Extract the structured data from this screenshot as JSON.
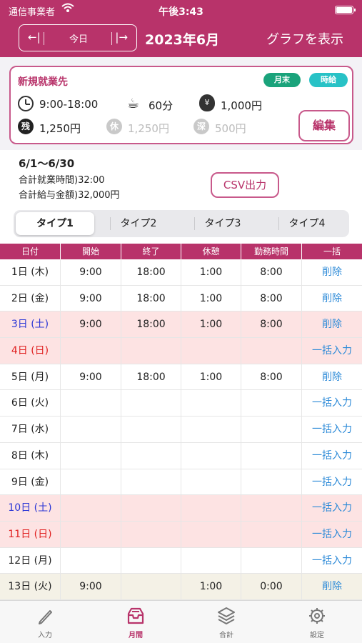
{
  "status": {
    "carrier": "通信事業者",
    "time": "午後3:43"
  },
  "header": {
    "prev": "←|",
    "today": "今日",
    "next": "|→",
    "month": "2023年6月",
    "graph": "グラフを表示"
  },
  "card": {
    "title": "新規就業先",
    "badge_month": "月末",
    "badge_hourly": "時給",
    "work_time": "9:00-18:00",
    "break": "60分",
    "wage": "1,000円",
    "overtime_label": "残",
    "overtime": "1,250円",
    "holiday_label": "休",
    "holiday": "1,250円",
    "night_label": "深",
    "night": "500円",
    "edit": "編集",
    "yen_symbol": "¥"
  },
  "summary": {
    "range": "6/1～6/30",
    "hours": "合計就業時間)32:00",
    "pay": "合計給与金額)32,000円",
    "csv": "CSV出力"
  },
  "segments": [
    "タイプ1",
    "タイプ2",
    "タイプ3",
    "タイプ4"
  ],
  "table": {
    "headers": [
      "日付",
      "開始",
      "終了",
      "休憩",
      "勤務時間",
      "一括"
    ],
    "rows": [
      {
        "date": "1日 (木)",
        "start": "9:00",
        "end": "18:00",
        "rest": "1:00",
        "work": "8:00",
        "action": "削除",
        "kind": ""
      },
      {
        "date": "2日 (金)",
        "start": "9:00",
        "end": "18:00",
        "rest": "1:00",
        "work": "8:00",
        "action": "削除",
        "kind": ""
      },
      {
        "date": "3日 (土)",
        "start": "9:00",
        "end": "18:00",
        "rest": "1:00",
        "work": "8:00",
        "action": "削除",
        "kind": "sat"
      },
      {
        "date": "4日 (日)",
        "start": "",
        "end": "",
        "rest": "",
        "work": "",
        "action": "一括入力",
        "kind": "sun"
      },
      {
        "date": "5日 (月)",
        "start": "9:00",
        "end": "18:00",
        "rest": "1:00",
        "work": "8:00",
        "action": "削除",
        "kind": ""
      },
      {
        "date": "6日 (火)",
        "start": "",
        "end": "",
        "rest": "",
        "work": "",
        "action": "一括入力",
        "kind": ""
      },
      {
        "date": "7日 (水)",
        "start": "",
        "end": "",
        "rest": "",
        "work": "",
        "action": "一括入力",
        "kind": ""
      },
      {
        "date": "8日 (木)",
        "start": "",
        "end": "",
        "rest": "",
        "work": "",
        "action": "一括入力",
        "kind": ""
      },
      {
        "date": "9日 (金)",
        "start": "",
        "end": "",
        "rest": "",
        "work": "",
        "action": "一括入力",
        "kind": ""
      },
      {
        "date": "10日 (土)",
        "start": "",
        "end": "",
        "rest": "",
        "work": "",
        "action": "一括入力",
        "kind": "sat"
      },
      {
        "date": "11日 (日)",
        "start": "",
        "end": "",
        "rest": "",
        "work": "",
        "action": "一括入力",
        "kind": "sun"
      },
      {
        "date": "12日 (月)",
        "start": "",
        "end": "",
        "rest": "",
        "work": "",
        "action": "一括入力",
        "kind": ""
      },
      {
        "date": "13日 (火)",
        "start": "9:00",
        "end": "",
        "rest": "1:00",
        "work": "0:00",
        "action": "削除",
        "kind": "today"
      }
    ]
  },
  "tabs": [
    {
      "label": "入力",
      "icon": "pencil-icon"
    },
    {
      "label": "月間",
      "icon": "inbox-tray-icon"
    },
    {
      "label": "合計",
      "icon": "layers-icon"
    },
    {
      "label": "設定",
      "icon": "gear-icon"
    }
  ],
  "colors": {
    "brand": "#b8336a",
    "saturday": "#2a36d6",
    "sunday": "#e02020",
    "action": "#2e8bd8",
    "weekend_bg": "#fde3e3",
    "today_bg": "#f4f1e6"
  }
}
